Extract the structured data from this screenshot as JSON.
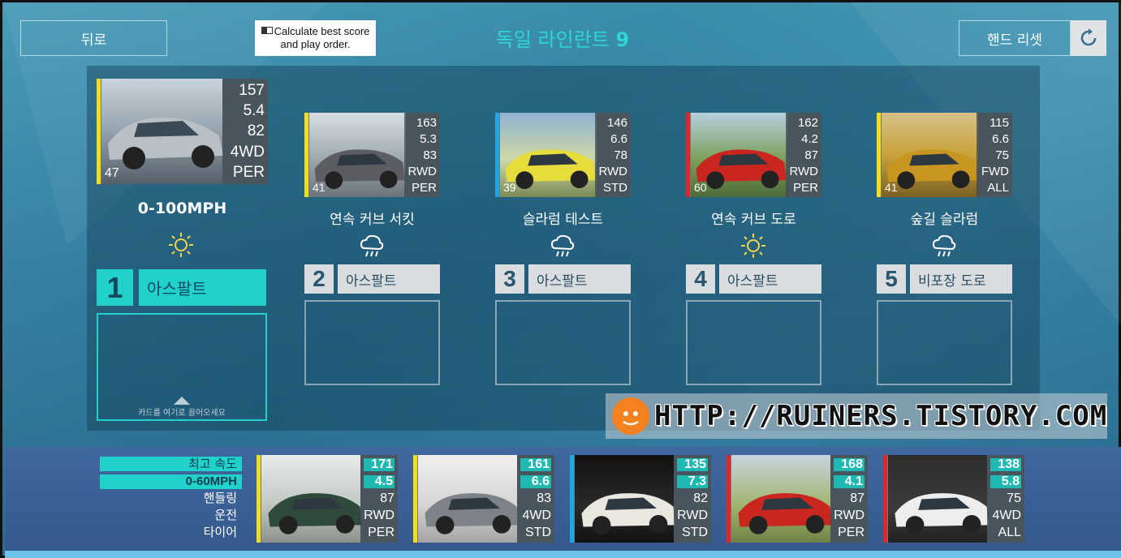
{
  "header": {
    "back_label": "뒤로",
    "calc_label": "Calculate best score and play order.",
    "title_text": "독일 라인란트",
    "title_number": "9",
    "reset_label": "핸드 리셋"
  },
  "events": [
    {
      "slot": "1",
      "name": "0-100MPH",
      "weather": "sun-icon",
      "surface": "아스팔트",
      "active": true,
      "drop_hint": "카드를 여기로 끌어오세요",
      "car": {
        "stats": [
          "157",
          "5.4",
          "82",
          "4WD",
          "PER"
        ],
        "rating": "47",
        "stripe": "#f2df1a"
      }
    },
    {
      "slot": "2",
      "name": "연속 커브 서킷",
      "weather": "rain-cloud-icon",
      "surface": "아스팔트",
      "car": {
        "stats": [
          "163",
          "5.3",
          "83",
          "RWD",
          "PER"
        ],
        "rating": "41",
        "stripe": "#f2df1a"
      }
    },
    {
      "slot": "3",
      "name": "슬라럼 테스트",
      "weather": "rain-cloud-icon",
      "surface": "아스팔트",
      "car": {
        "stats": [
          "146",
          "6.6",
          "78",
          "RWD",
          "STD"
        ],
        "rating": "39",
        "stripe": "#1ea7e0"
      }
    },
    {
      "slot": "4",
      "name": "연속 커브 도로",
      "weather": "sun-icon",
      "surface": "아스팔트",
      "car": {
        "stats": [
          "162",
          "4.2",
          "87",
          "RWD",
          "PER"
        ],
        "rating": "60",
        "stripe": "#e2242b"
      }
    },
    {
      "slot": "5",
      "name": "숲길 슬라럼",
      "weather": "rain-cloud-icon",
      "surface": "비포장 도로",
      "car": {
        "stats": [
          "115",
          "6.6",
          "75",
          "FWD",
          "ALL"
        ],
        "rating": "41",
        "stripe": "#f2df1a"
      }
    }
  ],
  "hand": {
    "legend": [
      "최고 속도",
      "0-60MPH",
      "핸들링",
      "운전",
      "타이어"
    ],
    "cards": [
      {
        "stats": [
          "171",
          "4.5",
          "87",
          "RWD",
          "PER"
        ],
        "stripe": "#f2df1a"
      },
      {
        "stats": [
          "161",
          "6.6",
          "83",
          "4WD",
          "STD"
        ],
        "stripe": "#f2df1a"
      },
      {
        "stats": [
          "135",
          "7.3",
          "82",
          "RWD",
          "STD"
        ],
        "stripe": "#1ea7e0"
      },
      {
        "stats": [
          "168",
          "4.1",
          "87",
          "RWD",
          "PER"
        ],
        "stripe": "#e2242b"
      },
      {
        "stats": [
          "138",
          "5.8",
          "75",
          "4WD",
          "ALL"
        ],
        "stripe": "#e2242b"
      }
    ]
  },
  "watermark": "HTTP://RUINERS.TISTORY.COM",
  "colors": {
    "accent": "#21d2cb",
    "title": "#2fd6d0"
  }
}
